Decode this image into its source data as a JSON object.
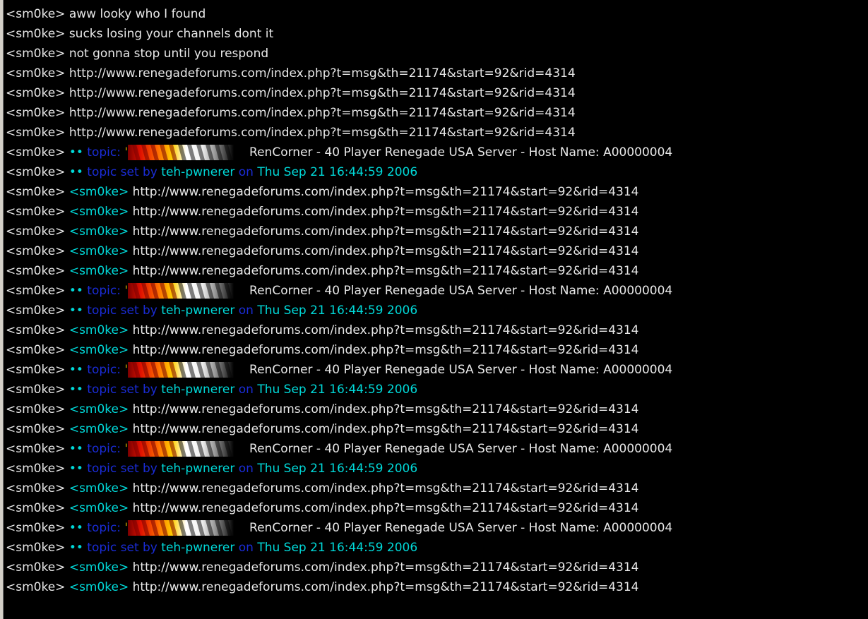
{
  "colors": {
    "background": "#000000",
    "text": "#e8e8e8",
    "cyan": "#00d8d8",
    "blue": "#1a2cd6"
  },
  "lines": [
    {
      "type": "msg",
      "nick": "<sm0ke>",
      "text": "aww looky who I found"
    },
    {
      "type": "msg",
      "nick": "<sm0ke>",
      "text": "sucks losing your channels dont it"
    },
    {
      "type": "msg",
      "nick": "<sm0ke>",
      "text": "not gonna stop until you respond"
    },
    {
      "type": "msg",
      "nick": "<sm0ke>",
      "text": "http://www.renegadeforums.com/index.php?t=msg&th=21174&start=92&rid=4314"
    },
    {
      "type": "msg",
      "nick": "<sm0ke>",
      "text": "http://www.renegadeforums.com/index.php?t=msg&th=21174&start=92&rid=4314"
    },
    {
      "type": "msg",
      "nick": "<sm0ke>",
      "text": "http://www.renegadeforums.com/index.php?t=msg&th=21174&start=92&rid=4314"
    },
    {
      "type": "msg",
      "nick": "<sm0ke>",
      "text": "http://www.renegadeforums.com/index.php?t=msg&th=21174&start=92&rid=4314"
    },
    {
      "type": "topic",
      "nick": "<sm0ke>",
      "bullet": "••",
      "kw": "topic:",
      "quote": "'",
      "text": "RenCorner - 40 Player Renegade USA Server - Host Name: A00000004"
    },
    {
      "type": "setby",
      "nick": "<sm0ke>",
      "bullet": "••",
      "kw": "topic set by",
      "setter": "teh-pwnerer",
      "on": "on",
      "date": "Thu Sep 21 16:44:59 2006"
    },
    {
      "type": "quoted",
      "nick": "<sm0ke>",
      "inner": "<sm0ke>",
      "text": "http://www.renegadeforums.com/index.php?t=msg&th=21174&start=92&rid=4314"
    },
    {
      "type": "quoted",
      "nick": "<sm0ke>",
      "inner": "<sm0ke>",
      "text": "http://www.renegadeforums.com/index.php?t=msg&th=21174&start=92&rid=4314"
    },
    {
      "type": "quoted",
      "nick": "<sm0ke>",
      "inner": "<sm0ke>",
      "text": "http://www.renegadeforums.com/index.php?t=msg&th=21174&start=92&rid=4314"
    },
    {
      "type": "quoted",
      "nick": "<sm0ke>",
      "inner": "<sm0ke>",
      "text": "http://www.renegadeforums.com/index.php?t=msg&th=21174&start=92&rid=4314"
    },
    {
      "type": "quoted",
      "nick": "<sm0ke>",
      "inner": "<sm0ke>",
      "text": "http://www.renegadeforums.com/index.php?t=msg&th=21174&start=92&rid=4314"
    },
    {
      "type": "topic",
      "nick": "<sm0ke>",
      "bullet": "••",
      "kw": "topic:",
      "quote": "'",
      "text": "RenCorner - 40 Player Renegade USA Server - Host Name: A00000004"
    },
    {
      "type": "setby",
      "nick": "<sm0ke>",
      "bullet": "••",
      "kw": "topic set by",
      "setter": "teh-pwnerer",
      "on": "on",
      "date": "Thu Sep 21 16:44:59 2006"
    },
    {
      "type": "quoted",
      "nick": "<sm0ke>",
      "inner": "<sm0ke>",
      "text": "http://www.renegadeforums.com/index.php?t=msg&th=21174&start=92&rid=4314"
    },
    {
      "type": "quoted",
      "nick": "<sm0ke>",
      "inner": "<sm0ke>",
      "text": "http://www.renegadeforums.com/index.php?t=msg&th=21174&start=92&rid=4314"
    },
    {
      "type": "topic",
      "nick": "<sm0ke>",
      "bullet": "••",
      "kw": "topic:",
      "quote": "'",
      "text": "RenCorner - 40 Player Renegade USA Server - Host Name: A00000004"
    },
    {
      "type": "setby",
      "nick": "<sm0ke>",
      "bullet": "••",
      "kw": "topic set by",
      "setter": "teh-pwnerer",
      "on": "on",
      "date": "Thu Sep 21 16:44:59 2006"
    },
    {
      "type": "quoted",
      "nick": "<sm0ke>",
      "inner": "<sm0ke>",
      "text": "http://www.renegadeforums.com/index.php?t=msg&th=21174&start=92&rid=4314"
    },
    {
      "type": "quoted",
      "nick": "<sm0ke>",
      "inner": "<sm0ke>",
      "text": "http://www.renegadeforums.com/index.php?t=msg&th=21174&start=92&rid=4314"
    },
    {
      "type": "topic",
      "nick": "<sm0ke>",
      "bullet": "••",
      "kw": "topic:",
      "quote": "'",
      "text": "RenCorner - 40 Player Renegade USA Server - Host Name: A00000004"
    },
    {
      "type": "setby",
      "nick": "<sm0ke>",
      "bullet": "••",
      "kw": "topic set by",
      "setter": "teh-pwnerer",
      "on": "on",
      "date": "Thu Sep 21 16:44:59 2006"
    },
    {
      "type": "quoted",
      "nick": "<sm0ke>",
      "inner": "<sm0ke>",
      "text": "http://www.renegadeforums.com/index.php?t=msg&th=21174&start=92&rid=4314"
    },
    {
      "type": "quoted",
      "nick": "<sm0ke>",
      "inner": "<sm0ke>",
      "text": "http://www.renegadeforums.com/index.php?t=msg&th=21174&start=92&rid=4314"
    },
    {
      "type": "topic",
      "nick": "<sm0ke>",
      "bullet": "••",
      "kw": "topic:",
      "quote": "'",
      "text": "RenCorner - 40 Player Renegade USA Server - Host Name: A00000004"
    },
    {
      "type": "setby",
      "nick": "<sm0ke>",
      "bullet": "••",
      "kw": "topic set by",
      "setter": "teh-pwnerer",
      "on": "on",
      "date": "Thu Sep 21 16:44:59 2006"
    },
    {
      "type": "quoted",
      "nick": "<sm0ke>",
      "inner": "<sm0ke>",
      "text": "http://www.renegadeforums.com/index.php?t=msg&th=21174&start=92&rid=4314"
    },
    {
      "type": "quoted",
      "nick": "<sm0ke>",
      "inner": "<sm0ke>",
      "text": "http://www.renegadeforums.com/index.php?t=msg&th=21174&start=92&rid=4314"
    }
  ]
}
